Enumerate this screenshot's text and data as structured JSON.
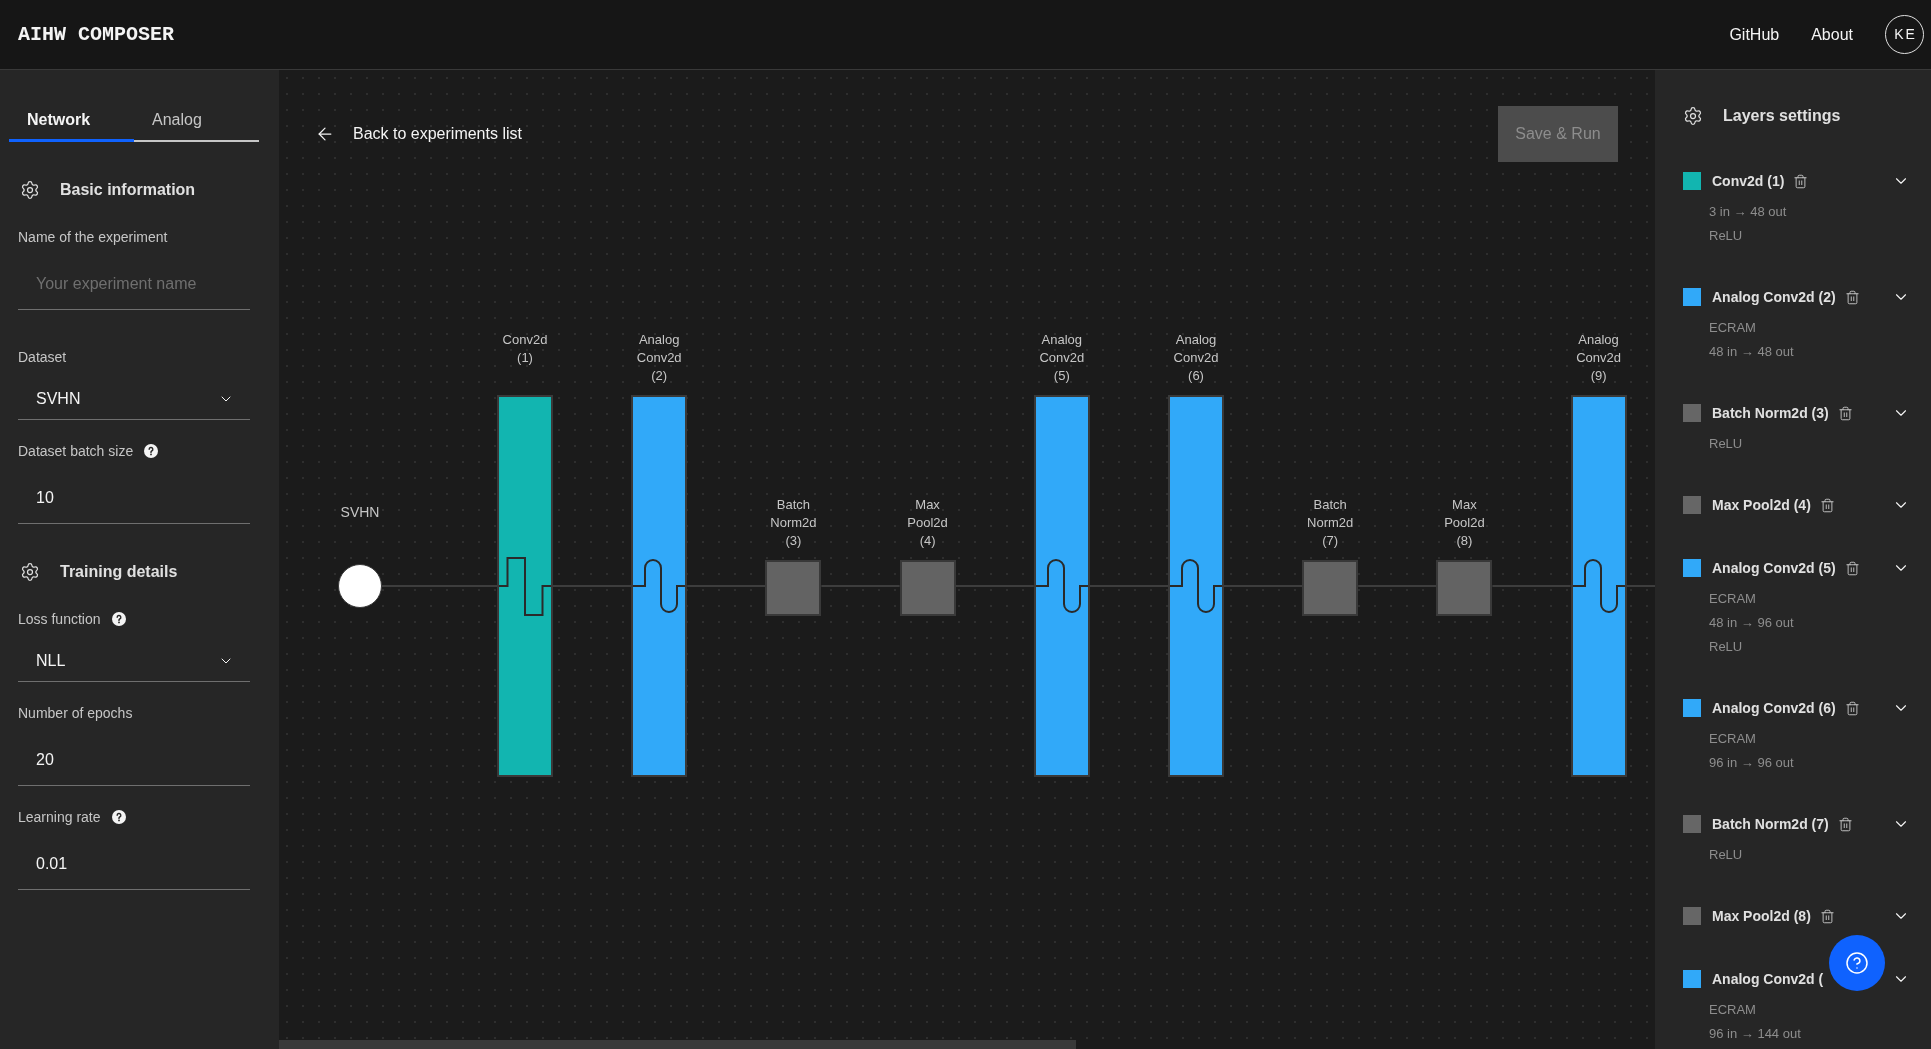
{
  "app": {
    "title": "AIHW COMPOSER",
    "nav_links": [
      "GitHub",
      "About"
    ],
    "avatar": "KE"
  },
  "sidebar": {
    "tabs": [
      {
        "label": "Network",
        "selected": true
      },
      {
        "label": "Analog",
        "selected": false
      }
    ],
    "sections": [
      {
        "title": "Basic information",
        "fields": [
          {
            "kind": "text",
            "label": "Name of the experiment",
            "help": false,
            "placeholder": "Your experiment name"
          },
          {
            "kind": "select",
            "label": "Dataset",
            "help": false,
            "value": "SVHN"
          },
          {
            "kind": "text",
            "label": "Dataset batch size",
            "help": true,
            "value": "10"
          }
        ]
      },
      {
        "title": "Training details",
        "fields": [
          {
            "kind": "select",
            "label": "Loss function",
            "help": true,
            "value": "NLL"
          },
          {
            "kind": "text",
            "label": "Number of epochs",
            "help": false,
            "value": "20"
          },
          {
            "kind": "text",
            "label": "Learning rate",
            "help": true,
            "value": "0.01"
          }
        ]
      }
    ]
  },
  "canvas": {
    "back_link": "Back to experiments list",
    "save_button": {
      "label": "Save & Run",
      "disabled": true
    },
    "input_node": {
      "label": "SVHN"
    },
    "nodes": [
      {
        "label": "Conv2d (1)",
        "kind": "conv",
        "color": "#12b5b0"
      },
      {
        "label": "Analog Conv2d (2)",
        "kind": "analog",
        "color": "#31a9f9"
      },
      {
        "label": "Batch Norm2d (3)",
        "kind": "norm",
        "color": "#636363"
      },
      {
        "label": "Max Pool2d (4)",
        "kind": "pool",
        "color": "#636363"
      },
      {
        "label": "Analog Conv2d (5)",
        "kind": "analog",
        "color": "#31a9f9"
      },
      {
        "label": "Analog Conv2d (6)",
        "kind": "analog",
        "color": "#31a9f9"
      },
      {
        "label": "Batch Norm2d (7)",
        "kind": "norm",
        "color": "#636363"
      },
      {
        "label": "Max Pool2d (8)",
        "kind": "pool",
        "color": "#636363"
      },
      {
        "label": "Analog Conv2d (9)",
        "kind": "analog",
        "color": "#31a9f9"
      }
    ]
  },
  "layers_panel": {
    "title": "Layers settings",
    "layers": [
      {
        "title": "Conv2d (1)",
        "color": "#12b5b0",
        "deletable": true,
        "details": [
          "3 in → 48 out",
          "ReLU"
        ]
      },
      {
        "title": "Analog Conv2d (2)",
        "color": "#31a9f9",
        "deletable": true,
        "details": [
          "ECRAM",
          "48 in → 48 out"
        ]
      },
      {
        "title": "Batch Norm2d (3)",
        "color": "#666666",
        "deletable": true,
        "details": [
          "ReLU"
        ]
      },
      {
        "title": "Max Pool2d (4)",
        "color": "#666666",
        "deletable": true
      },
      {
        "title": "Analog Conv2d (5)",
        "color": "#31a9f9",
        "deletable": true,
        "details": [
          "ECRAM",
          "48 in → 96 out",
          "ReLU"
        ]
      },
      {
        "title": "Analog Conv2d (6)",
        "color": "#31a9f9",
        "deletable": true,
        "details": [
          "ECRAM",
          "96 in → 96 out"
        ]
      },
      {
        "title": "Batch Norm2d (7)",
        "color": "#666666",
        "deletable": true,
        "details": [
          "ReLU"
        ]
      },
      {
        "title": "Max Pool2d (8)",
        "color": "#666666",
        "deletable": true
      },
      {
        "title": "Analog Conv2d (",
        "color": "#31a9f9",
        "deletable": false,
        "details": [
          "ECRAM",
          "96 in → 144 out"
        ]
      }
    ]
  }
}
